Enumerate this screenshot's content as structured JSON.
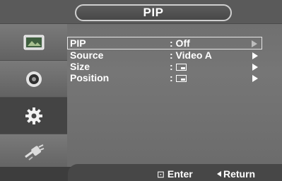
{
  "header": {
    "title": "PIP"
  },
  "sidebar": {
    "items": [
      {
        "icon": "picture-icon"
      },
      {
        "icon": "sound-icon"
      },
      {
        "icon": "setup-gear-icon",
        "active": true
      },
      {
        "icon": "input-plug-icon"
      }
    ]
  },
  "menu": {
    "rows": [
      {
        "label": "PIP",
        "value": ": Off"
      },
      {
        "label": "Source",
        "value": ": Video A"
      },
      {
        "label": "Size",
        "value": ":"
      },
      {
        "label": "Position",
        "value": ":"
      }
    ]
  },
  "footer": {
    "enter_label": "Enter",
    "return_label": "Return"
  }
}
